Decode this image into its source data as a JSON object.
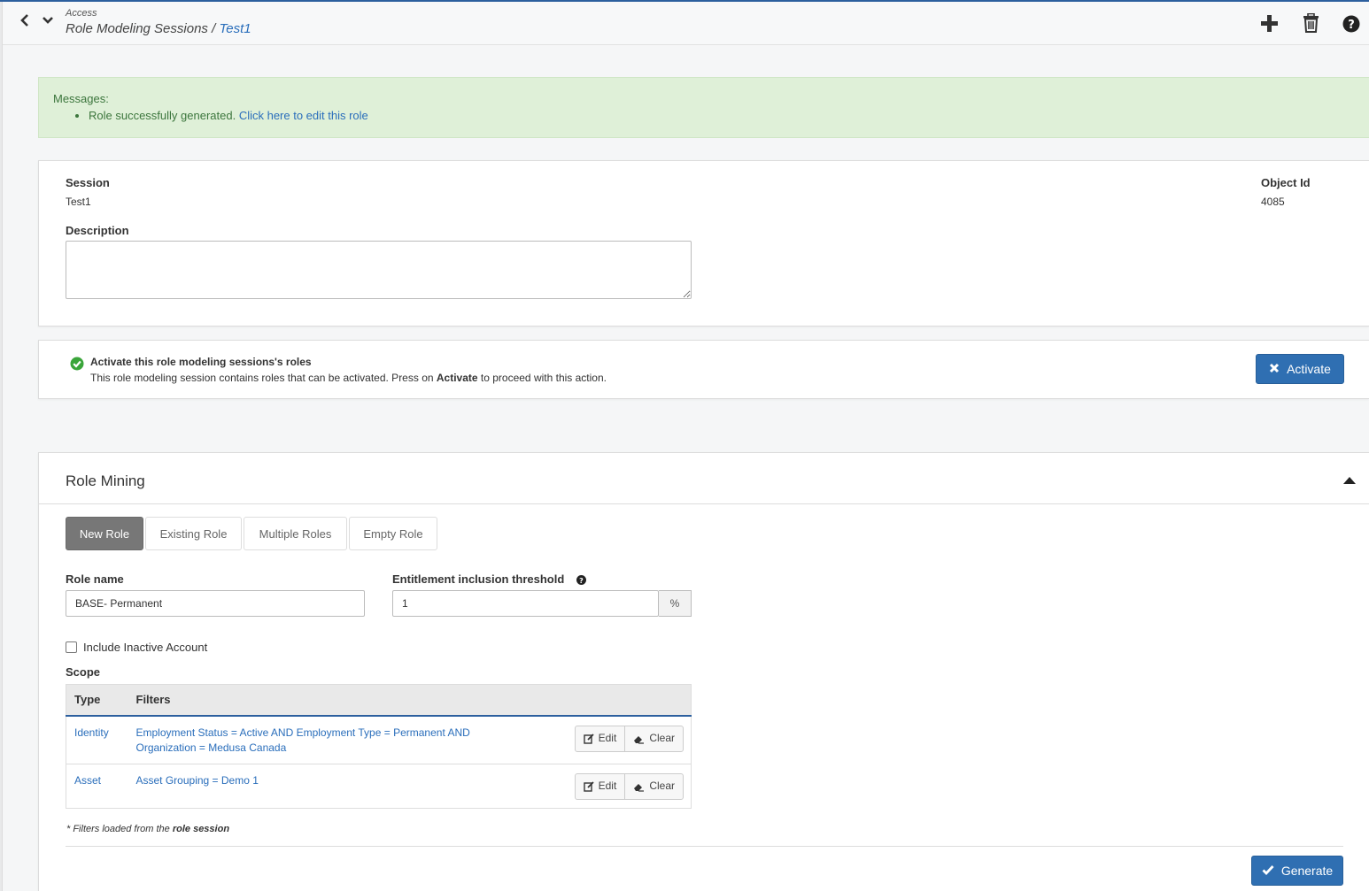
{
  "header": {
    "section": "Access",
    "breadcrumb_parent": "Role Modeling Sessions",
    "breadcrumb_sep": " / ",
    "breadcrumb_current": "Test1"
  },
  "messages": {
    "title": "Messages:",
    "text": "Role successfully generated. ",
    "link": "Click here to edit this role"
  },
  "session": {
    "session_label": "Session",
    "session_value": "Test1",
    "object_id_label": "Object Id",
    "object_id_value": "4085",
    "description_label": "Description",
    "description_value": ""
  },
  "activate": {
    "title": "Activate this role modeling sessions's roles",
    "text_before": "This role modeling session contains roles that can be activated. Press on ",
    "text_bold": "Activate",
    "text_after": " to proceed with this action.",
    "button_label": "Activate"
  },
  "role_mining": {
    "title": "Role Mining",
    "tabs": [
      "New Role",
      "Existing Role",
      "Multiple Roles",
      "Empty Role"
    ],
    "active_tab": "New Role",
    "role_name_label": "Role name",
    "role_name_value": "BASE- Permanent",
    "threshold_label": "Entitlement inclusion threshold",
    "threshold_value": "1",
    "threshold_unit": "%",
    "include_inactive_label": "Include Inactive Account",
    "include_inactive_checked": false,
    "scope_label": "Scope",
    "scope_columns": [
      "Type",
      "Filters"
    ],
    "scope_rows": [
      {
        "type": "Identity",
        "filters": "Employment Status = Active AND Employment Type = Permanent AND Organization = Medusa Canada",
        "edit": "Edit",
        "clear": "Clear"
      },
      {
        "type": "Asset",
        "filters": "Asset Grouping = Demo 1",
        "edit": "Edit",
        "clear": "Clear"
      }
    ],
    "footnote_prefix": "* Filters loaded from the ",
    "footnote_bold": "role session",
    "generate_label": "Generate"
  },
  "colors": {
    "primary": "#2f6fb2",
    "link": "#2a6ebb",
    "success_bg": "#dff0d8",
    "success_text": "#3c763d"
  }
}
